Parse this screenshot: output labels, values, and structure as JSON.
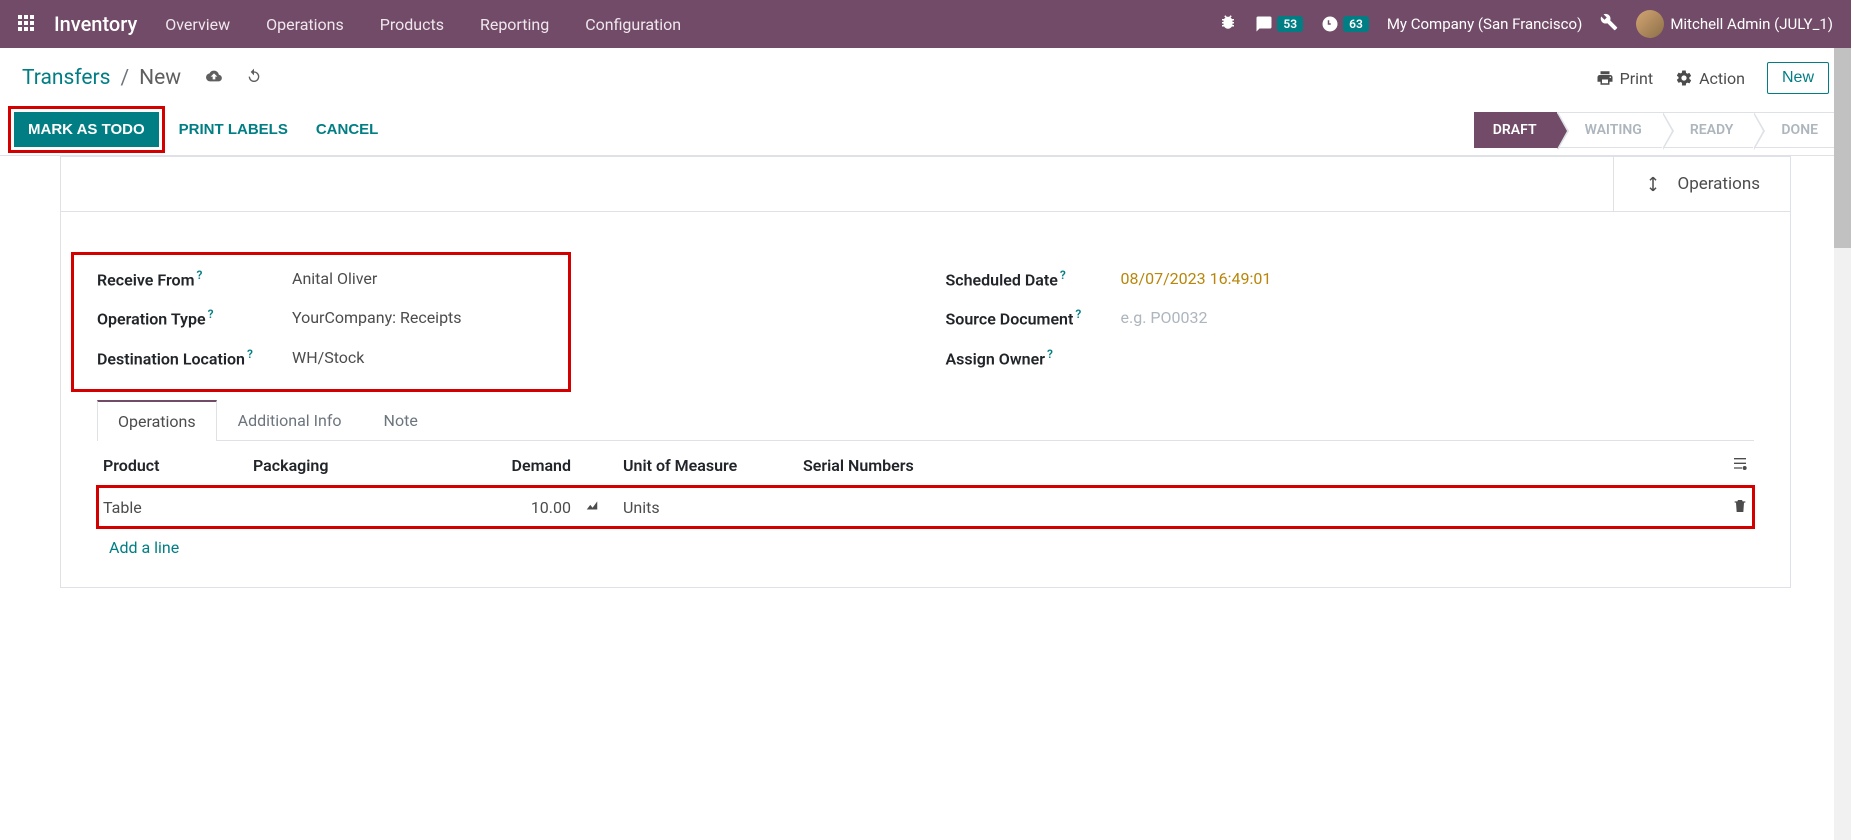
{
  "navbar": {
    "brand": "Inventory",
    "menu": [
      "Overview",
      "Operations",
      "Products",
      "Reporting",
      "Configuration"
    ],
    "msg_badge": "53",
    "clock_badge": "63",
    "company": "My Company (San Francisco)",
    "user": "Mitchell Admin (JULY_1)"
  },
  "breadcrumb": {
    "parent": "Transfers",
    "current": "New"
  },
  "controls": {
    "print": "Print",
    "action": "Action",
    "new": "New"
  },
  "buttons": {
    "mark_todo": "MARK AS TODO",
    "print_labels": "PRINT LABELS",
    "cancel": "CANCEL"
  },
  "status_steps": [
    "DRAFT",
    "WAITING",
    "READY",
    "DONE"
  ],
  "ops_button": "Operations",
  "fields": {
    "receive_from_label": "Receive From",
    "receive_from_value": "Anital Oliver",
    "operation_type_label": "Operation Type",
    "operation_type_value": "YourCompany: Receipts",
    "destination_label": "Destination Location",
    "destination_value": "WH/Stock",
    "scheduled_label": "Scheduled Date",
    "scheduled_value": "08/07/2023 16:49:01",
    "source_doc_label": "Source Document",
    "source_doc_placeholder": "e.g. PO0032",
    "assign_owner_label": "Assign Owner"
  },
  "tabs": [
    "Operations",
    "Additional Info",
    "Note"
  ],
  "table": {
    "headers": {
      "product": "Product",
      "packaging": "Packaging",
      "demand": "Demand",
      "uom": "Unit of Measure",
      "serial": "Serial Numbers"
    },
    "row": {
      "product": "Table",
      "packaging": "",
      "demand": "10.00",
      "uom": "Units",
      "serial": ""
    },
    "add_line": "Add a line"
  }
}
